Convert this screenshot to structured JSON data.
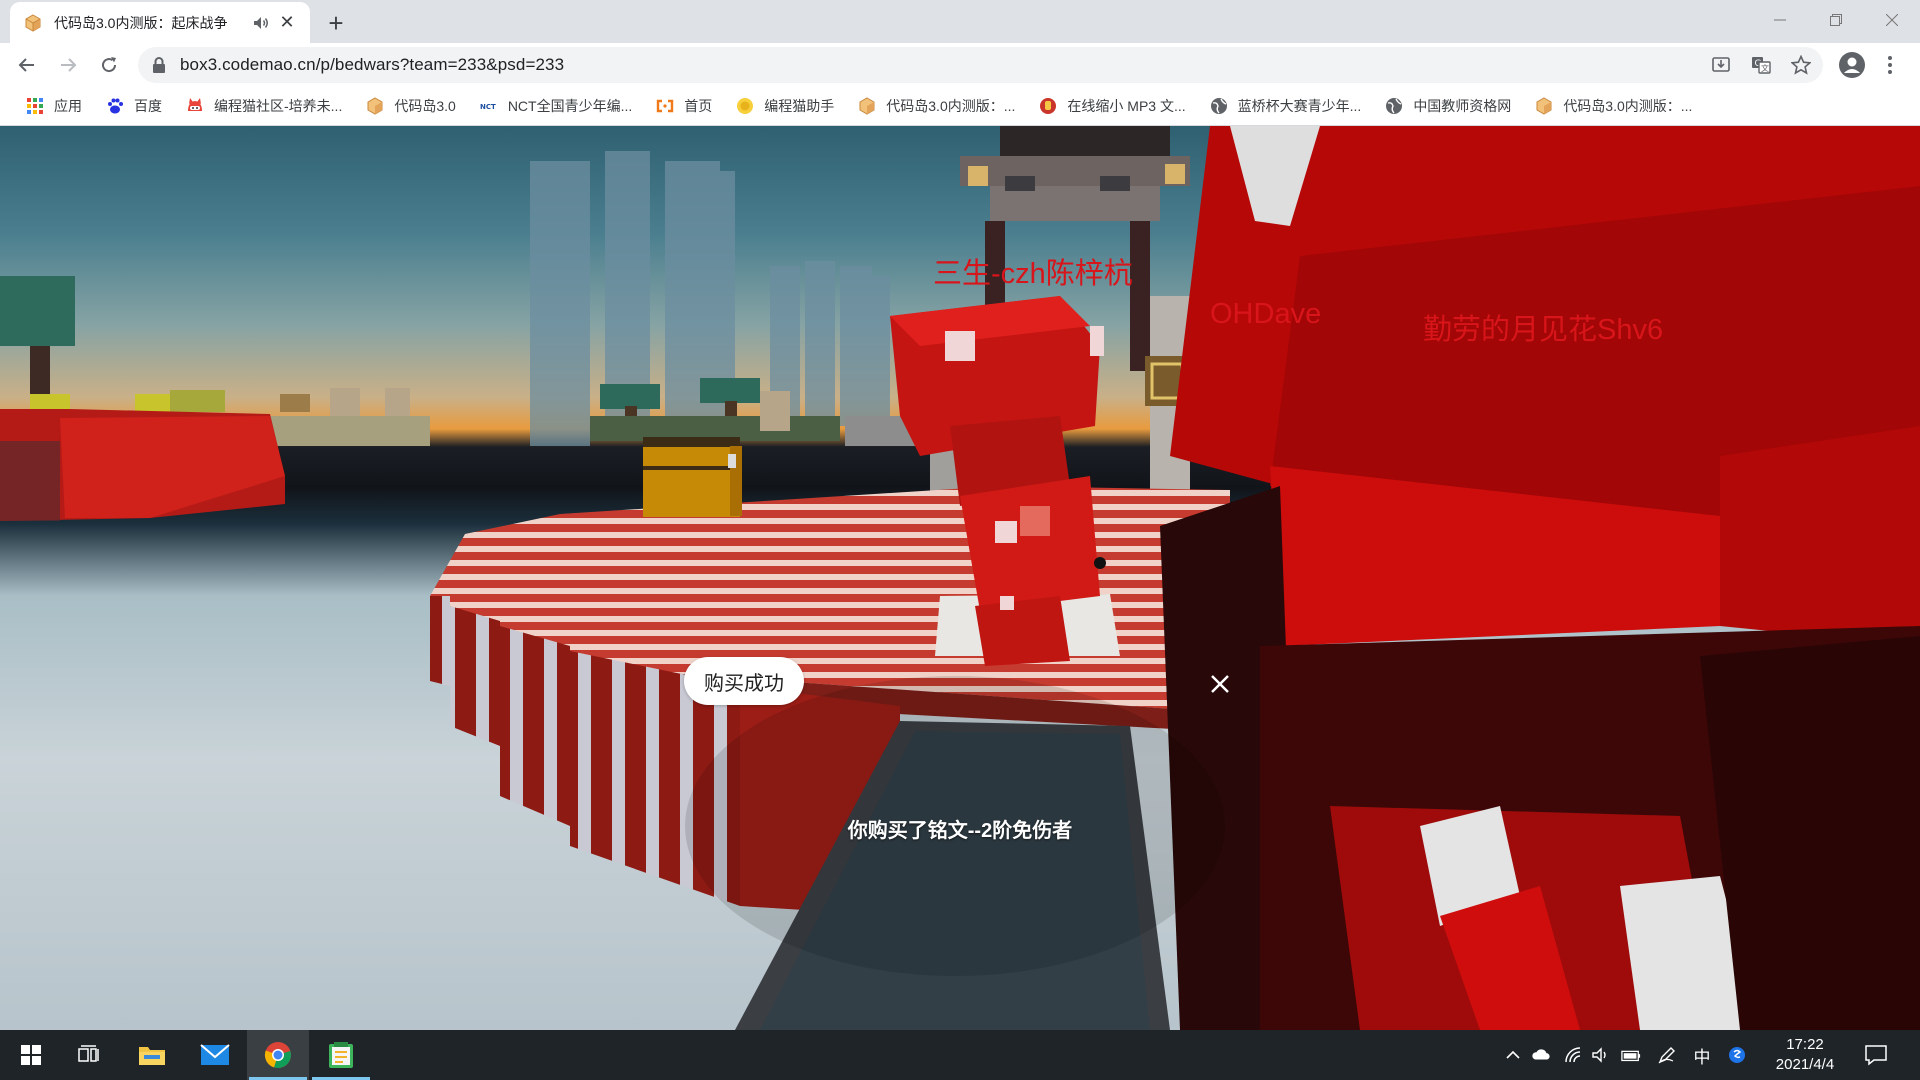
{
  "browser": {
    "tab": {
      "title": "代码岛3.0内测版：起床战争"
    },
    "url": "box3.codemao.cn/p/bedwars?team=233&psd=233",
    "bookmarks": [
      {
        "label": "应用",
        "icon": "apps-grid-icon"
      },
      {
        "label": "百度",
        "icon": "baidu-paw-icon"
      },
      {
        "label": "编程猫社区-培养未...",
        "icon": "codemao-cat-icon"
      },
      {
        "label": "代码岛3.0",
        "icon": "box3-cube-icon"
      },
      {
        "label": "NCT全国青少年编...",
        "icon": "nct-logo-icon"
      },
      {
        "label": "首页",
        "icon": "home-bracket-icon"
      },
      {
        "label": "编程猫助手",
        "icon": "assistant-icon"
      },
      {
        "label": "代码岛3.0内测版：...",
        "icon": "box3-cube-icon"
      },
      {
        "label": "在线缩小 MP3 文...",
        "icon": "mp3-icon"
      },
      {
        "label": "蓝桥杯大赛青少年...",
        "icon": "globe-icon"
      },
      {
        "label": "中国教师资格网",
        "icon": "globe-icon"
      },
      {
        "label": "代码岛3.0内测版：...",
        "icon": "box3-cube-icon"
      }
    ]
  },
  "game": {
    "nametags": {
      "player1": "三生-czh陈梓杭",
      "player2": "OHDave",
      "player3": "勤劳的月见花Shv6"
    },
    "toast": "购买成功",
    "purchase_message": "你购买了铭文--2阶免伤者"
  },
  "taskbar": {
    "ime_label": "中",
    "time": "17:22",
    "date": "2021/4/4"
  }
}
